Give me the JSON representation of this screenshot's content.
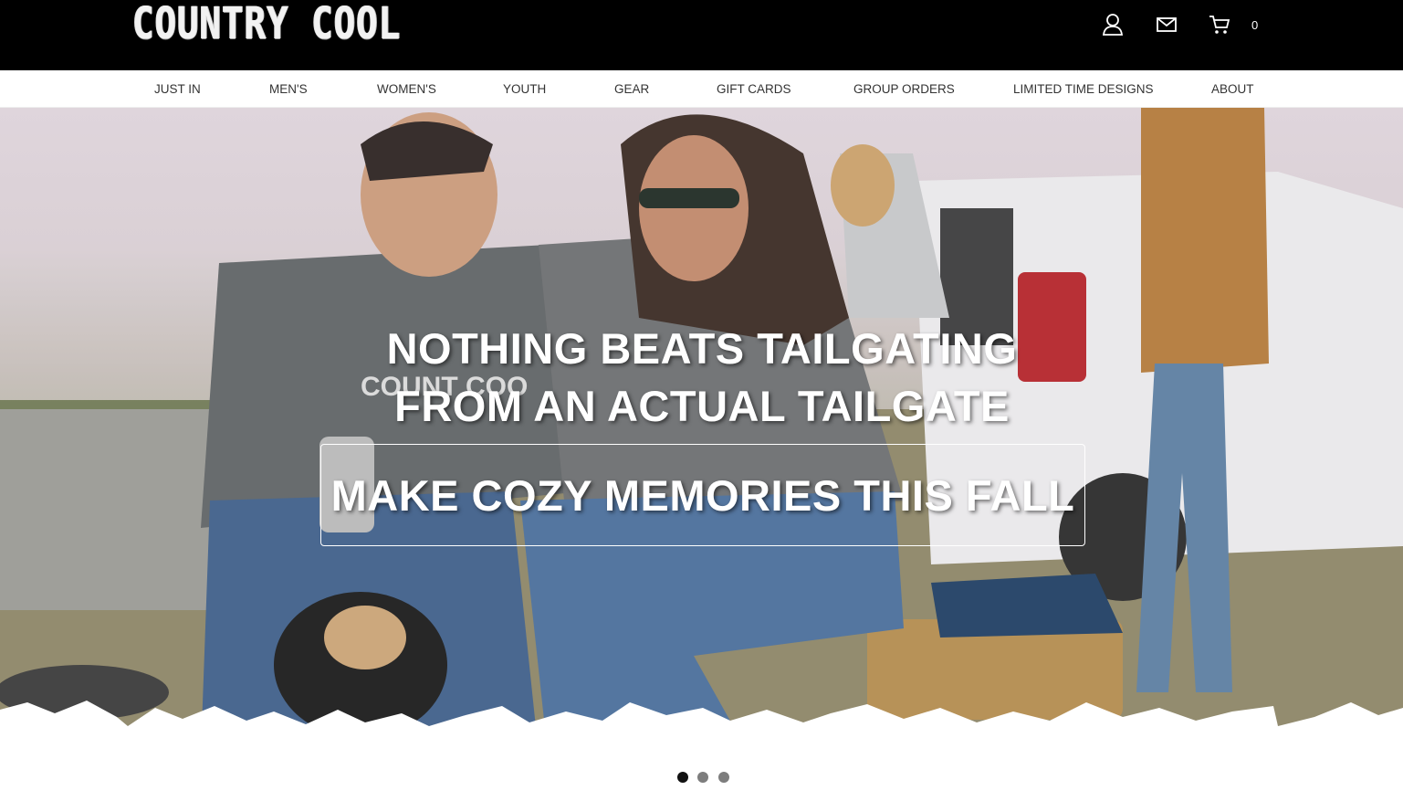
{
  "header": {
    "logo_text": "COUNTRY COOL",
    "icons": [
      "user-icon",
      "mail-icon",
      "cart-icon"
    ],
    "cart_count": "0"
  },
  "nav": {
    "items": [
      {
        "label": "JUST IN"
      },
      {
        "label": "MEN'S"
      },
      {
        "label": "WOMEN'S"
      },
      {
        "label": "YOUTH"
      },
      {
        "label": "GEAR"
      },
      {
        "label": "GIFT CARDS"
      },
      {
        "label": "GROUP ORDERS"
      },
      {
        "label": "LIMITED TIME DESIGNS"
      },
      {
        "label": "ABOUT"
      }
    ]
  },
  "hero": {
    "headline_line1": "NOTHING BEATS TAILGATING",
    "headline_line2": "FROM AN ACTUAL TAILGATE",
    "cta_label": "MAKE COZY MEMORIES THIS FALL",
    "sweatshirt_text": "COUNTRY COOL"
  },
  "carousel": {
    "slide_count": 3,
    "active_index": 0
  },
  "colors": {
    "header_bg": "#000000",
    "nav_text": "#333333",
    "dot_active": "#111111",
    "dot_inactive": "#7d7d7d"
  }
}
